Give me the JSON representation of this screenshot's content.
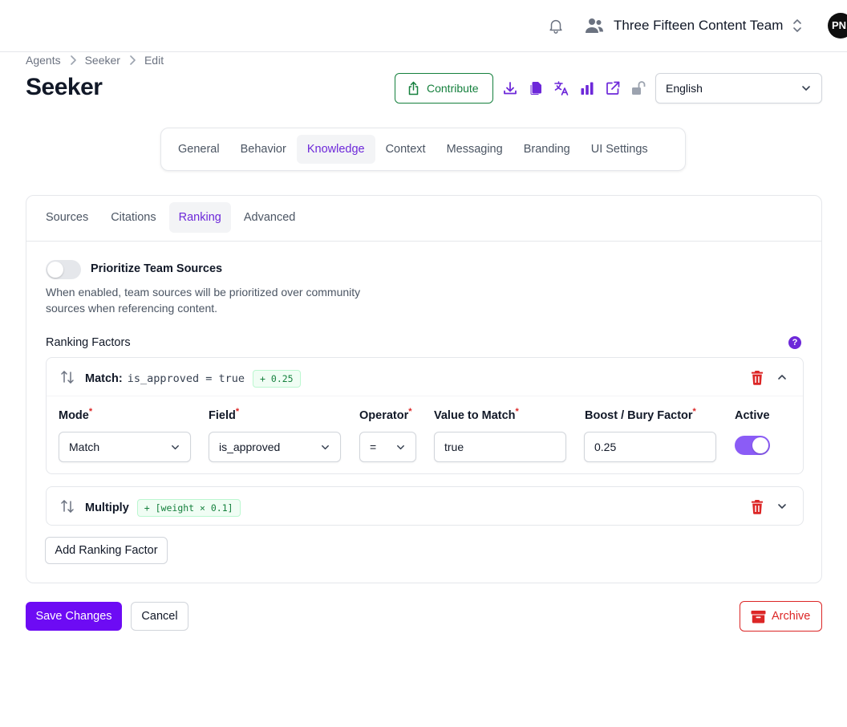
{
  "header": {
    "team_name": "Three Fifteen Content Team",
    "avatar_initials": "PN"
  },
  "breadcrumb": [
    "Agents",
    "Seeker",
    "Edit"
  ],
  "page": {
    "title": "Seeker"
  },
  "toolbar": {
    "contribute_label": "Contribute",
    "language": "English",
    "accent_color": "#6d28d9",
    "icons": [
      "download-icon",
      "copy-icon",
      "translate-icon",
      "analytics-icon",
      "external-link-icon",
      "unlock-icon"
    ]
  },
  "main_tabs": [
    "General",
    "Behavior",
    "Knowledge",
    "Context",
    "Messaging",
    "Branding",
    "UI Settings"
  ],
  "main_tab_active": "Knowledge",
  "sub_tabs": [
    "Sources",
    "Citations",
    "Ranking",
    "Advanced"
  ],
  "sub_tab_active": "Ranking",
  "prioritize": {
    "label": "Prioritize Team Sources",
    "description": "When enabled, team sources will be prioritized over community sources when referencing content.",
    "enabled": false
  },
  "ranking": {
    "section_label": "Ranking Factors",
    "help": "?",
    "factors": [
      {
        "type_label": "Match:",
        "expression": "is_approved = true",
        "badge": "+ 0.25",
        "expanded": true,
        "fields": {
          "mode_label": "Mode",
          "mode_value": "Match",
          "field_label": "Field",
          "field_value": "is_approved",
          "operator_label": "Operator",
          "operator_value": "=",
          "value_label": "Value to Match",
          "value_value": "true",
          "boost_label": "Boost / Bury Factor",
          "boost_value": "0.25",
          "active_label": "Active",
          "active": true,
          "required_mark": "*"
        }
      },
      {
        "type_label": "Multiply",
        "badge": "+ [weight × 0.1]",
        "expanded": false
      }
    ],
    "add_label": "Add Ranking Factor"
  },
  "actions": {
    "save_label": "Save Changes",
    "cancel_label": "Cancel",
    "archive_label": "Archive",
    "primary_color": "#6d0bf4",
    "danger_color": "#dc2626"
  }
}
